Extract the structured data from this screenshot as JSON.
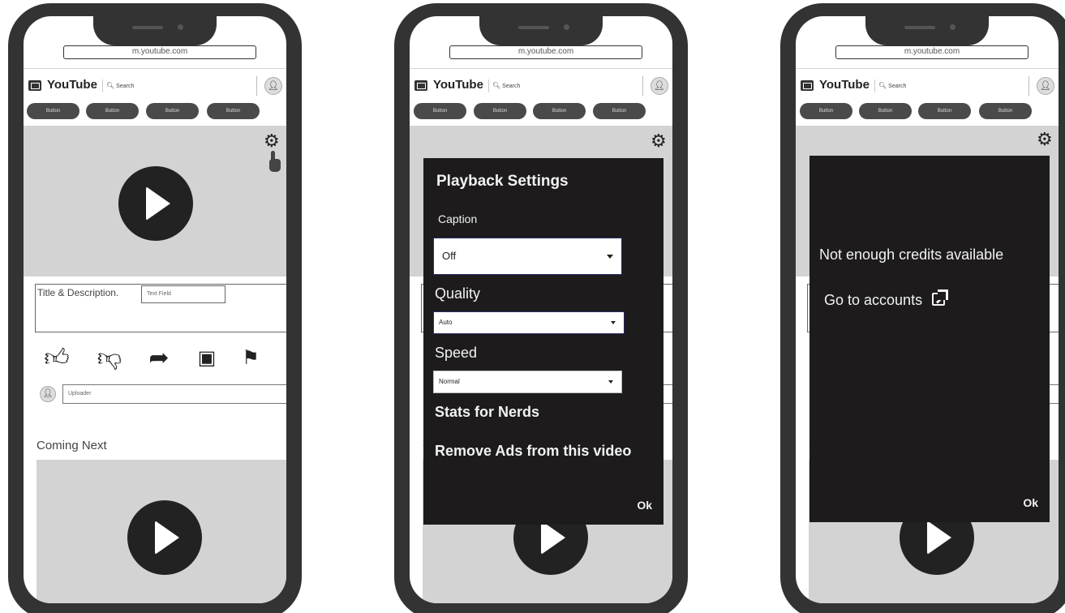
{
  "browser": {
    "url": "m.youtube.com"
  },
  "app": {
    "title": "YouTube",
    "search_placeholder": "Search"
  },
  "chips": [
    "Button",
    "Button",
    "Button",
    "Button"
  ],
  "video": {
    "title_description": "Title & Description.",
    "text_field": "Text Field"
  },
  "actions": [
    "thumbs-up-icon",
    "thumbs-down-icon",
    "share-icon",
    "save-icon",
    "flag-icon"
  ],
  "uploader": {
    "placeholder": "Uploader"
  },
  "coming_next": "Coming Next",
  "settings_dialog": {
    "title": "Playback Settings",
    "caption_label": "Caption",
    "caption_value": "Off",
    "quality_label": "Quality",
    "quality_value": "Auto",
    "speed_label": "Speed",
    "speed_value": "Normal",
    "stats_label": "Stats for Nerds",
    "remove_ads_label": "Remove Ads from this video",
    "ok_label": "Ok"
  },
  "credits_dialog": {
    "message": "Not enough credits available",
    "link_label": "Go to accounts",
    "ok_label": "Ok"
  },
  "colors": {
    "frame": "#333333",
    "dialog": "#1d1b1c",
    "video_placeholder": "#d3d3d3",
    "chip": "#4a4a4a"
  }
}
